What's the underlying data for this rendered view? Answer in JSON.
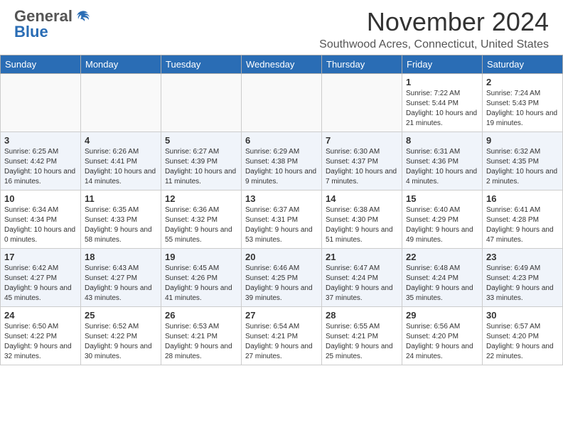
{
  "header": {
    "logo_general": "General",
    "logo_blue": "Blue",
    "month_title": "November 2024",
    "location": "Southwood Acres, Connecticut, United States"
  },
  "weekdays": [
    "Sunday",
    "Monday",
    "Tuesday",
    "Wednesday",
    "Thursday",
    "Friday",
    "Saturday"
  ],
  "weeks": [
    [
      {
        "day": "",
        "info": ""
      },
      {
        "day": "",
        "info": ""
      },
      {
        "day": "",
        "info": ""
      },
      {
        "day": "",
        "info": ""
      },
      {
        "day": "",
        "info": ""
      },
      {
        "day": "1",
        "info": "Sunrise: 7:22 AM\nSunset: 5:44 PM\nDaylight: 10 hours and 21 minutes."
      },
      {
        "day": "2",
        "info": "Sunrise: 7:24 AM\nSunset: 5:43 PM\nDaylight: 10 hours and 19 minutes."
      }
    ],
    [
      {
        "day": "3",
        "info": "Sunrise: 6:25 AM\nSunset: 4:42 PM\nDaylight: 10 hours and 16 minutes."
      },
      {
        "day": "4",
        "info": "Sunrise: 6:26 AM\nSunset: 4:41 PM\nDaylight: 10 hours and 14 minutes."
      },
      {
        "day": "5",
        "info": "Sunrise: 6:27 AM\nSunset: 4:39 PM\nDaylight: 10 hours and 11 minutes."
      },
      {
        "day": "6",
        "info": "Sunrise: 6:29 AM\nSunset: 4:38 PM\nDaylight: 10 hours and 9 minutes."
      },
      {
        "day": "7",
        "info": "Sunrise: 6:30 AM\nSunset: 4:37 PM\nDaylight: 10 hours and 7 minutes."
      },
      {
        "day": "8",
        "info": "Sunrise: 6:31 AM\nSunset: 4:36 PM\nDaylight: 10 hours and 4 minutes."
      },
      {
        "day": "9",
        "info": "Sunrise: 6:32 AM\nSunset: 4:35 PM\nDaylight: 10 hours and 2 minutes."
      }
    ],
    [
      {
        "day": "10",
        "info": "Sunrise: 6:34 AM\nSunset: 4:34 PM\nDaylight: 10 hours and 0 minutes."
      },
      {
        "day": "11",
        "info": "Sunrise: 6:35 AM\nSunset: 4:33 PM\nDaylight: 9 hours and 58 minutes."
      },
      {
        "day": "12",
        "info": "Sunrise: 6:36 AM\nSunset: 4:32 PM\nDaylight: 9 hours and 55 minutes."
      },
      {
        "day": "13",
        "info": "Sunrise: 6:37 AM\nSunset: 4:31 PM\nDaylight: 9 hours and 53 minutes."
      },
      {
        "day": "14",
        "info": "Sunrise: 6:38 AM\nSunset: 4:30 PM\nDaylight: 9 hours and 51 minutes."
      },
      {
        "day": "15",
        "info": "Sunrise: 6:40 AM\nSunset: 4:29 PM\nDaylight: 9 hours and 49 minutes."
      },
      {
        "day": "16",
        "info": "Sunrise: 6:41 AM\nSunset: 4:28 PM\nDaylight: 9 hours and 47 minutes."
      }
    ],
    [
      {
        "day": "17",
        "info": "Sunrise: 6:42 AM\nSunset: 4:27 PM\nDaylight: 9 hours and 45 minutes."
      },
      {
        "day": "18",
        "info": "Sunrise: 6:43 AM\nSunset: 4:27 PM\nDaylight: 9 hours and 43 minutes."
      },
      {
        "day": "19",
        "info": "Sunrise: 6:45 AM\nSunset: 4:26 PM\nDaylight: 9 hours and 41 minutes."
      },
      {
        "day": "20",
        "info": "Sunrise: 6:46 AM\nSunset: 4:25 PM\nDaylight: 9 hours and 39 minutes."
      },
      {
        "day": "21",
        "info": "Sunrise: 6:47 AM\nSunset: 4:24 PM\nDaylight: 9 hours and 37 minutes."
      },
      {
        "day": "22",
        "info": "Sunrise: 6:48 AM\nSunset: 4:24 PM\nDaylight: 9 hours and 35 minutes."
      },
      {
        "day": "23",
        "info": "Sunrise: 6:49 AM\nSunset: 4:23 PM\nDaylight: 9 hours and 33 minutes."
      }
    ],
    [
      {
        "day": "24",
        "info": "Sunrise: 6:50 AM\nSunset: 4:22 PM\nDaylight: 9 hours and 32 minutes."
      },
      {
        "day": "25",
        "info": "Sunrise: 6:52 AM\nSunset: 4:22 PM\nDaylight: 9 hours and 30 minutes."
      },
      {
        "day": "26",
        "info": "Sunrise: 6:53 AM\nSunset: 4:21 PM\nDaylight: 9 hours and 28 minutes."
      },
      {
        "day": "27",
        "info": "Sunrise: 6:54 AM\nSunset: 4:21 PM\nDaylight: 9 hours and 27 minutes."
      },
      {
        "day": "28",
        "info": "Sunrise: 6:55 AM\nSunset: 4:21 PM\nDaylight: 9 hours and 25 minutes."
      },
      {
        "day": "29",
        "info": "Sunrise: 6:56 AM\nSunset: 4:20 PM\nDaylight: 9 hours and 24 minutes."
      },
      {
        "day": "30",
        "info": "Sunrise: 6:57 AM\nSunset: 4:20 PM\nDaylight: 9 hours and 22 minutes."
      }
    ]
  ]
}
